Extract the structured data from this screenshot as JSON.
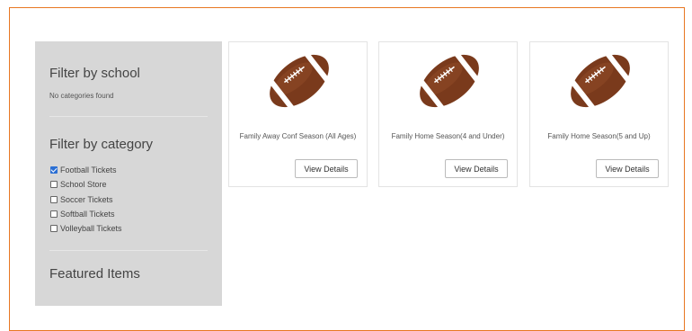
{
  "sidebar": {
    "school_title": "Filter by school",
    "school_empty": "No categories found",
    "category_title": "Filter by category",
    "categories": [
      {
        "label": "Football Tickets",
        "checked": true
      },
      {
        "label": "School Store",
        "checked": false
      },
      {
        "label": "Soccer Tickets",
        "checked": false
      },
      {
        "label": "Softball Tickets",
        "checked": false
      },
      {
        "label": "Volleyball Tickets",
        "checked": false
      }
    ],
    "featured_title": "Featured Items"
  },
  "products": [
    {
      "name": "Family Away Conf Season (All Ages)",
      "button": "View Details",
      "image": "football-image"
    },
    {
      "name": "Family Home Season(4 and Under)",
      "button": "View Details",
      "image": "football-image"
    },
    {
      "name": "Family Home Season(5 and Up)",
      "button": "View Details",
      "image": "football-image"
    }
  ],
  "colors": {
    "accent_border": "#e87722",
    "sidebar_bg": "#d7d7d7",
    "checkbox_checked": "#2b6fd4",
    "football_brown": "#7a3a1c",
    "football_stripe": "#ffffff"
  }
}
